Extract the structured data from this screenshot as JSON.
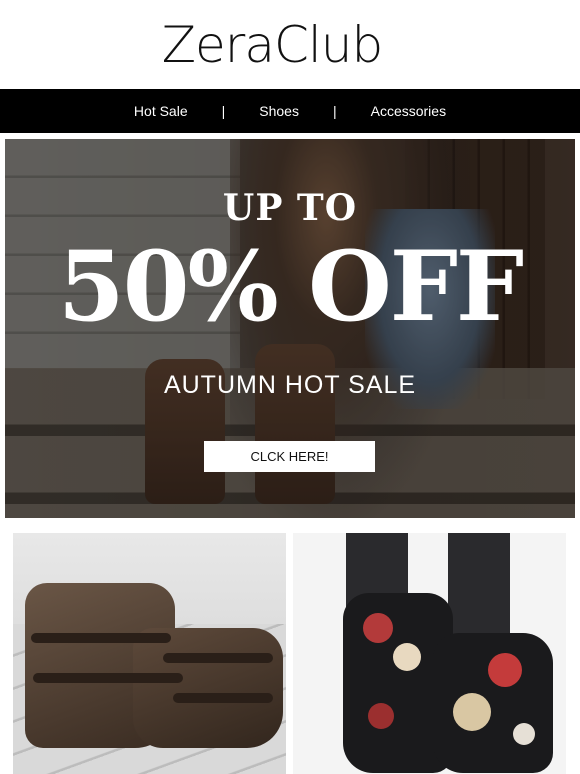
{
  "brand": {
    "name": "ZeraClub"
  },
  "nav": {
    "items": [
      "Hot Sale",
      "Shoes",
      "Accessories"
    ],
    "separator": "|"
  },
  "hero": {
    "line1": "UP TO",
    "line2": "50% OFF",
    "line3": "AUTUMN HOT SALE",
    "cta_label": "CLCK HERE!"
  },
  "products": [
    {
      "name": "studded-strap-boots"
    },
    {
      "name": "floral-print-combat-boots"
    }
  ],
  "colors": {
    "nav_bg": "#000000",
    "nav_text": "#ffffff",
    "cta_bg": "#ffffff"
  }
}
